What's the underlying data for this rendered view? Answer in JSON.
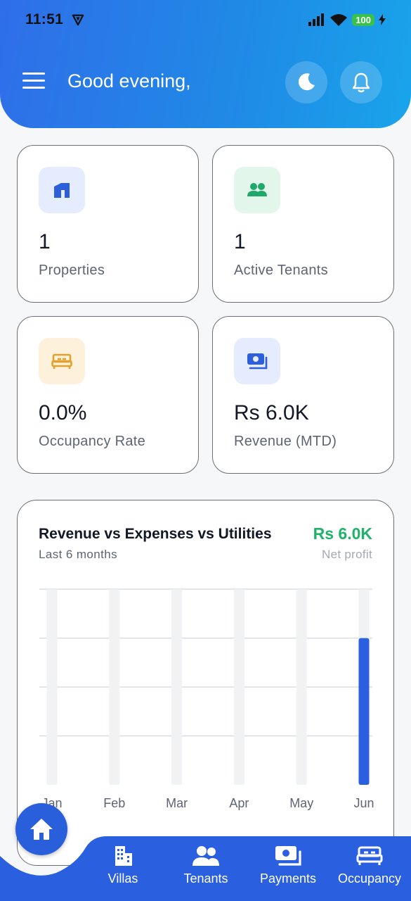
{
  "status_bar": {
    "time": "11:51",
    "battery": "100"
  },
  "header": {
    "greeting": "Good evening,"
  },
  "stats": [
    {
      "value": "1",
      "label": "Properties",
      "icon": "building-icon",
      "icon_color": "#2d5fd8",
      "icon_bg": "#e5ecfd"
    },
    {
      "value": "1",
      "label": "Active Tenants",
      "icon": "people-icon",
      "icon_color": "#1ea86a",
      "icon_bg": "#e2f6ec"
    },
    {
      "value": "0.0%",
      "label": "Occupancy Rate",
      "icon": "bed-icon",
      "icon_color": "#e0a22c",
      "icon_bg": "#fdf1dc"
    },
    {
      "value": "Rs 6.0K",
      "label": "Revenue (MTD)",
      "icon": "cash-icon",
      "icon_color": "#2d5fd8",
      "icon_bg": "#e5ecfd"
    }
  ],
  "chart": {
    "title": "Revenue vs Expenses vs Utilities",
    "subtitle": "Last 6 months",
    "net_value": "Rs 6.0K",
    "net_label": "Net profit"
  },
  "chart_data": {
    "type": "bar",
    "categories": [
      "Jan",
      "Feb",
      "Mar",
      "Apr",
      "May",
      "Jun"
    ],
    "values": [
      0,
      0,
      0,
      0,
      0,
      6000
    ],
    "ylim": [
      0,
      8000
    ],
    "grid": true,
    "colors": {
      "bar": "#2a5fe0",
      "track": "#f1f2f4",
      "grid": "#d6d8dc"
    }
  },
  "nav": [
    {
      "label": "Villas",
      "icon": "buildings-icon"
    },
    {
      "label": "Tenants",
      "icon": "people-icon"
    },
    {
      "label": "Payments",
      "icon": "cash-icon"
    },
    {
      "label": "Occupancy",
      "icon": "bed-icon"
    }
  ],
  "colors": {
    "primary": "#2a5fe0",
    "positive": "#20b26b"
  }
}
